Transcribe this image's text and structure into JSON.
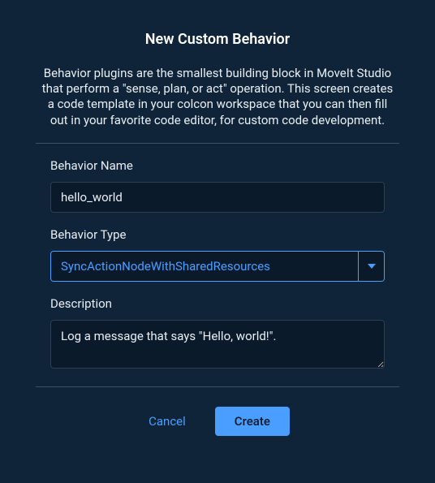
{
  "dialog": {
    "title": "New Custom Behavior",
    "description": "Behavior plugins are the smallest building block in MoveIt Studio that perform a \"sense, plan, or act\" operation. This screen creates a code template in your colcon workspace that you can then fill out in your favorite code editor, for custom code development."
  },
  "form": {
    "name": {
      "label": "Behavior Name",
      "value": "hello_world"
    },
    "type": {
      "label": "Behavior Type",
      "value": "SyncActionNodeWithSharedResources"
    },
    "description": {
      "label": "Description",
      "value": "Log a message that says \"Hello, world!\"."
    }
  },
  "actions": {
    "cancel": "Cancel",
    "create": "Create"
  }
}
